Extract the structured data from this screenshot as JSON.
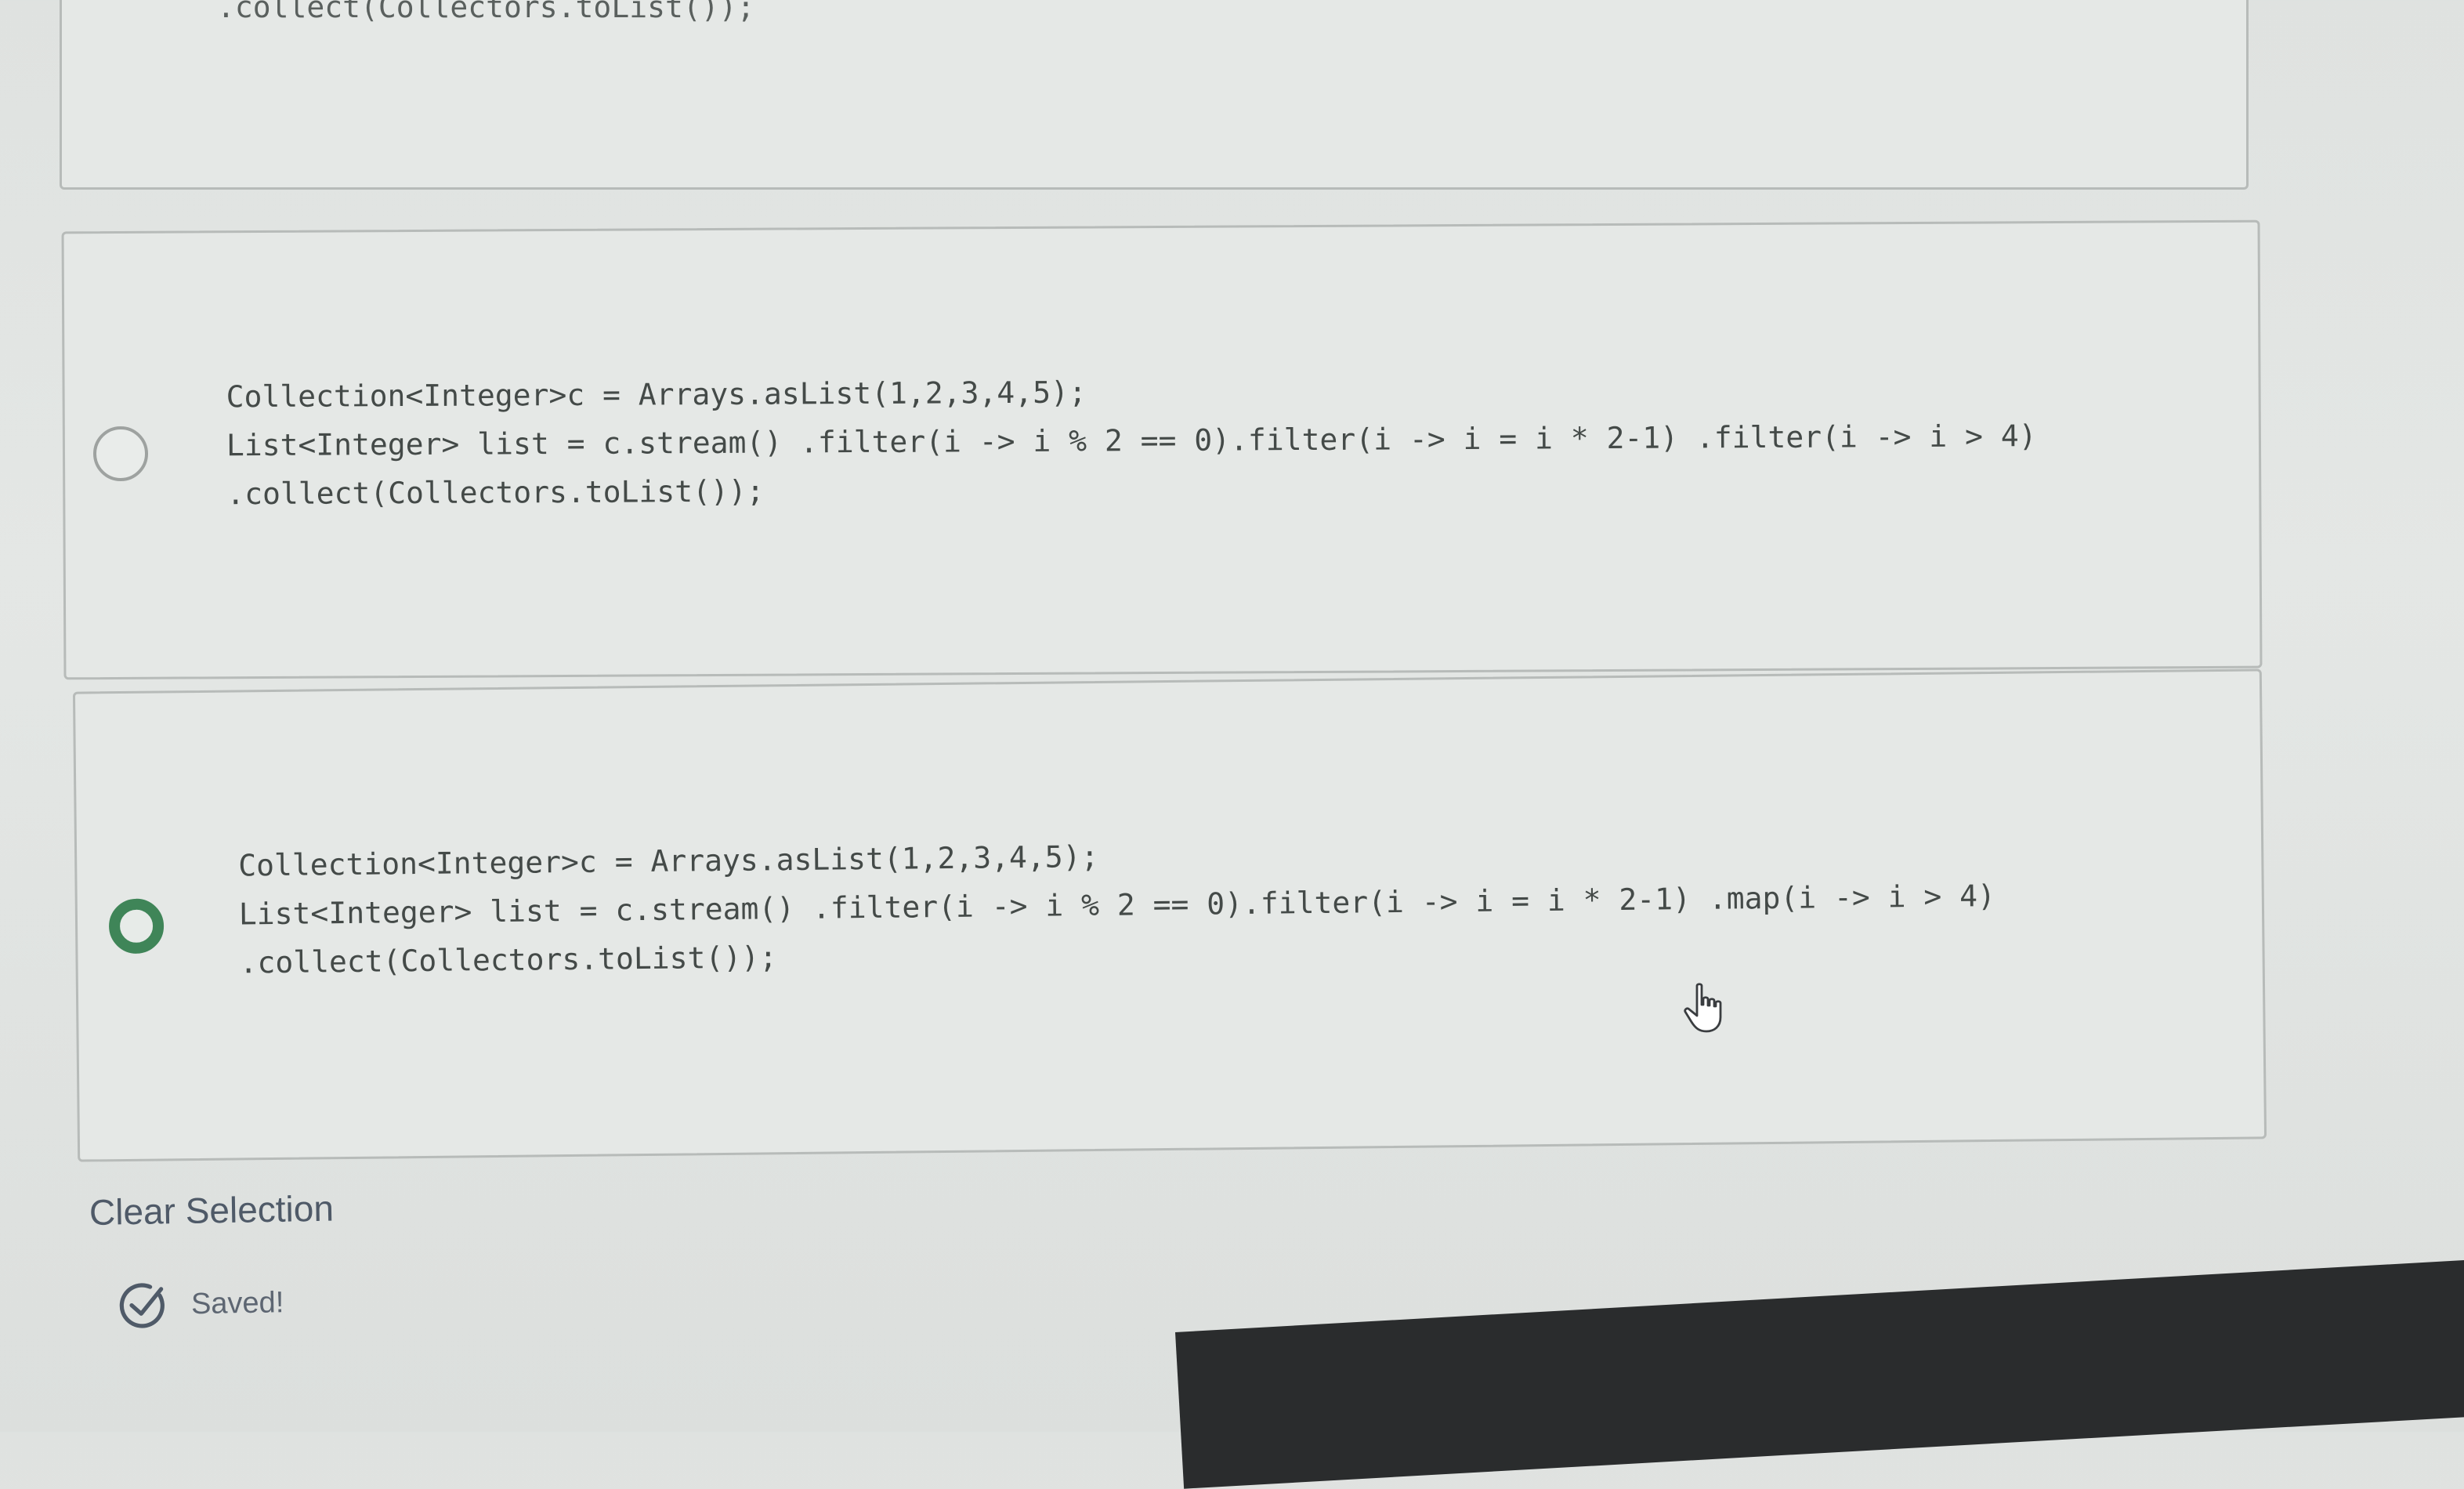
{
  "options": [
    {
      "selected": false,
      "code_lines": [
        ".collect(Collectors.toList());"
      ]
    },
    {
      "selected": false,
      "code_lines": [
        "Collection<Integer>c = Arrays.asList(1,2,3,4,5);",
        "List<Integer> list = c.stream() .filter(i -> i % 2 == 0).filter(i -> i = i * 2-1) .filter(i -> i > 4)",
        ".collect(Collectors.toList());"
      ]
    },
    {
      "selected": true,
      "code_lines": [
        "Collection<Integer>c = Arrays.asList(1,2,3,4,5);",
        "List<Integer> list = c.stream() .filter(i -> i % 2 == 0).filter(i -> i = i * 2-1) .map(i -> i > 4)",
        ".collect(Collectors.toList());"
      ]
    }
  ],
  "actions": {
    "clear_selection_label": "Clear Selection"
  },
  "status": {
    "saved_label": "Saved!",
    "icon": "check-circle-icon"
  },
  "colors": {
    "radio_selected": "#3f8558",
    "radio_unselected": "#9ea2a0",
    "link_text": "#4f5a68",
    "code_text": "#444a48"
  }
}
